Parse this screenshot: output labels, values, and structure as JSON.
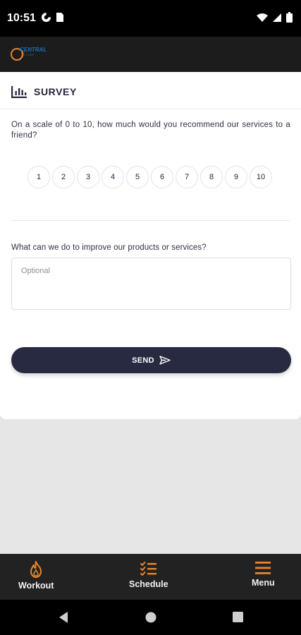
{
  "status_bar": {
    "time": "10:51"
  },
  "app": {
    "logo_text": "CENTRAL",
    "logo_subtext": "FIT CORP"
  },
  "survey": {
    "title": "SURVEY",
    "question1": "On a scale of 0 to 10, how much would you recommend our services to a friend?",
    "scale": [
      "1",
      "2",
      "3",
      "4",
      "5",
      "6",
      "7",
      "8",
      "9",
      "10"
    ],
    "question2": "What can we do to improve our products or services?",
    "feedback_placeholder": "Optional",
    "send_label": "SEND"
  },
  "bottom_nav": {
    "items": [
      {
        "label": "Workout",
        "icon": "flame-icon"
      },
      {
        "label": "Schedule",
        "icon": "checklist-icon"
      },
      {
        "label": "Menu",
        "icon": "hamburger-icon"
      }
    ]
  },
  "colors": {
    "accent": "#e8862a",
    "dark": "#272a40",
    "nav_bg": "#222222",
    "app_bar_bg": "#1c1c1c"
  }
}
